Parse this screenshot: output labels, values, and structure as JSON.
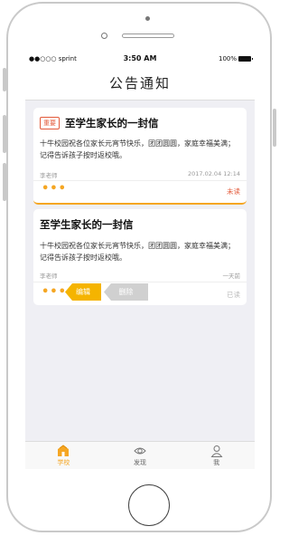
{
  "status_bar": {
    "carrier": "●●○○○ sprint",
    "time": "3:50 AM",
    "battery": "100%"
  },
  "nav": {
    "title": "公告通知"
  },
  "notices": [
    {
      "badge": "重要",
      "title": "至学生家长的一封信",
      "body": "十牛校园祝各位家长元宵节快乐，团团圆圆，家庭幸福美满；记得告诉孩子按时返校哦。",
      "author": "李老师",
      "time": "2017.02.04 12:14",
      "more": "•••",
      "read_status": "未读"
    },
    {
      "title": "至学生家长的一封信",
      "body": "十牛校园祝各位家长元宵节快乐，团团圆圆，家庭幸福美满；记得告诉孩子按时返校哦。",
      "author": "李老师",
      "time": "一天前",
      "more": "•••",
      "edit_label": "编辑",
      "delete_label": "删除",
      "read_status": "已读"
    }
  ],
  "tabs": [
    {
      "label": "学校",
      "icon": "school-icon",
      "active": true
    },
    {
      "label": "发现",
      "icon": "eye-icon",
      "active": false
    },
    {
      "label": "我",
      "icon": "person-icon",
      "active": false
    }
  ],
  "colors": {
    "accent": "#f5a623",
    "alert": "#e35a3a",
    "delete": "#d0d0d0",
    "background": "#efeff4"
  }
}
